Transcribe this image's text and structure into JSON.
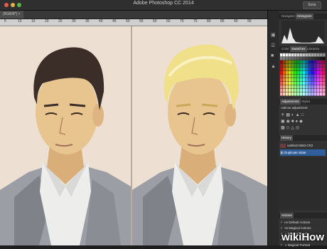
{
  "window": {
    "title": "Adobe Photoshop CC 2014",
    "workspace_label": "Ezra"
  },
  "document": {
    "tab_label": "(RGB/8*) ×"
  },
  "ruler": {
    "labels": [
      "5",
      "10",
      "15",
      "20",
      "25",
      "30",
      "35",
      "40",
      "45",
      "50",
      "55",
      "60",
      "65",
      "70",
      "75",
      "80",
      "85",
      "90",
      "95"
    ]
  },
  "panels": {
    "histogram": {
      "tabs": [
        "Navigator",
        "Histogram"
      ]
    },
    "swatches": {
      "tabs": [
        "Color",
        "Swatches",
        "Libraries"
      ]
    },
    "adjustments": {
      "tabs": [
        "Adjustments",
        "Styles"
      ],
      "hint": "Add an adjustment"
    },
    "history": {
      "tab": "History",
      "items": [
        {
          "label": "untitled-0683.CR2",
          "selected": false
        },
        {
          "label": "Duplicate State",
          "selected": true
        }
      ]
    },
    "actions": {
      "tab": "Actions",
      "items": [
        "Default Actions",
        "Magical Actions",
        "Magical Brush",
        "Magical Landscape",
        "Magical Portrait"
      ]
    }
  },
  "watermark": {
    "text": "wikiHow"
  },
  "colors": {
    "background": "#ede0d3",
    "hair_before": "#3b2e28",
    "hair_after": "#f1e08a",
    "skin": "#e8c48e",
    "suit": "#9b9ea4",
    "shirt": "#ededec",
    "selection": "#2f5e9a"
  },
  "illustration": {
    "left": "portrait-dark-hair",
    "right": "portrait-blond-hair"
  }
}
